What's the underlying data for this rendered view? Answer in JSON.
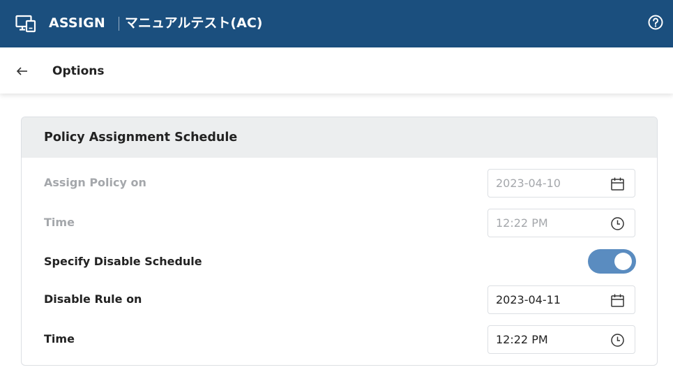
{
  "header": {
    "icon": "monitor-icon",
    "title": "ASSIGN",
    "subtitle": "マニュアルテスト(AC)",
    "help_icon": "help-circle-icon",
    "background_color": "#1b4f7e"
  },
  "subbar": {
    "back_icon": "arrow-left-icon",
    "title": "Options"
  },
  "card": {
    "title": "Policy Assignment Schedule",
    "rows": [
      {
        "label": "Assign Policy on",
        "value": "2023-04-10",
        "icon": "calendar-icon",
        "disabled": true
      },
      {
        "label": "Time",
        "value": "12:22 PM",
        "icon": "clock-icon",
        "disabled": true
      },
      {
        "label": "Specify Disable Schedule",
        "toggle_on": true,
        "toggle_color": "#5a8cc0"
      },
      {
        "label": "Disable Rule on",
        "value": "2023-04-11",
        "icon": "calendar-icon",
        "disabled": false
      },
      {
        "label": "Time",
        "value": "12:22 PM",
        "icon": "clock-icon",
        "disabled": false
      }
    ]
  }
}
